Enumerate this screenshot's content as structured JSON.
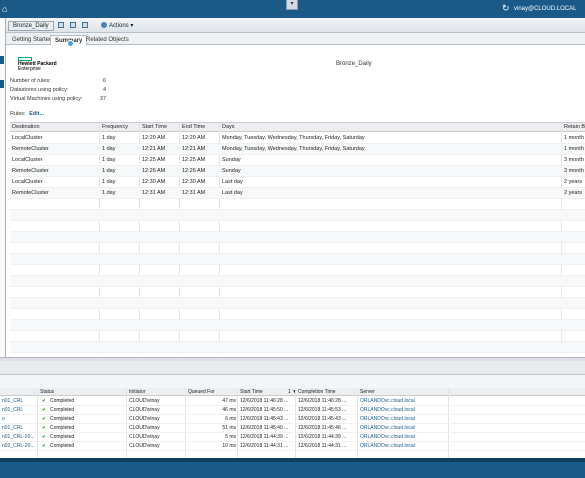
{
  "header": {
    "user": "vinay@CLOUD.LOCAL"
  },
  "toolbar": {
    "object_name": "Bronze_Daily",
    "actions_label": "Actions"
  },
  "tabs": [
    "Getting Started",
    "Summary",
    "Related Objects"
  ],
  "summary": {
    "logo_line1": "Hewlett Packard",
    "logo_line2": "Enterprise",
    "policy_name": "Bronze_Daily",
    "stats": [
      {
        "label": "Number of rules:",
        "value": "6"
      },
      {
        "label": "Datastores using policy:",
        "value": "4"
      },
      {
        "label": "Virtual Machines using policy:",
        "value": "37"
      }
    ],
    "rules_label": "Rules:",
    "edit_link": "Edit..."
  },
  "rules_table": {
    "columns": [
      "Destination",
      "Frequency",
      "Start Time",
      "End Time",
      "Days",
      "Retain B"
    ],
    "rows": [
      [
        "LocalCluster",
        "1 day",
        "12:20 AM",
        "12:20 AM",
        "Monday, Tuesday, Wednesday, Thursday, Friday, Saturday",
        "1 month"
      ],
      [
        "RemoteCluster",
        "1 day",
        "12:21 AM",
        "12:21 AM",
        "Monday, Tuesday, Wednesday, Thursday, Friday, Saturday",
        "1 month"
      ],
      [
        "LocalCluster",
        "1 day",
        "12:25 AM",
        "12:25 AM",
        "Sunday",
        "3 month"
      ],
      [
        "RemoteCluster",
        "1 day",
        "12:26 AM",
        "12:26 AM",
        "Sunday",
        "3 month"
      ],
      [
        "LocalCluster",
        "1 day",
        "12:30 AM",
        "12:30 AM",
        "Last day",
        "2 years"
      ],
      [
        "RemoteCluster",
        "1 day",
        "12:31 AM",
        "12:31 AM",
        "Last day",
        "2 years"
      ]
    ]
  },
  "tasks_table": {
    "columns": [
      "",
      "Status",
      "Initiator",
      "Queued For",
      "Start Time",
      "Completion Time",
      "Server"
    ],
    "sort_indicator": "1 ▼",
    "rows": [
      [
        "n01_CRL",
        "Completed",
        "CLOUD\\vinay",
        "47 ms",
        "12/6/2018 11:46:28 ...",
        "12/6/2018 11:46:28 ...",
        "ORLANDOvc.cloud.local"
      ],
      [
        "n01_CRL",
        "Completed",
        "CLOUD\\vinay",
        "46 ms",
        "12/6/2018 11:45:50 ...",
        "12/6/2018 11:45:53 ...",
        "ORLANDOvc.cloud.local"
      ],
      [
        "o",
        "Completed",
        "CLOUD\\vinay",
        "6 ms",
        "12/6/2018 11:45:43 ...",
        "12/6/2018 11:45:43 ...",
        "ORLANDOvc.cloud.local"
      ],
      [
        "n01_CRL",
        "Completed",
        "CLOUD\\vinay",
        "51 ms",
        "12/6/2018 11:45:40 ...",
        "12/6/2018 11:45:46 ...",
        "ORLANDOvc.cloud.local"
      ],
      [
        "n01_CRL-20...",
        "Completed",
        "CLOUD\\vinay",
        "5 ms",
        "12/6/2018 11:44:39 ...",
        "12/6/2018 11:44:39 ...",
        "ORLANDOvc.cloud.local"
      ],
      [
        "n02_CRL-20...",
        "Completed",
        "CLOUD\\vinay",
        "10 ms",
        "12/6/2018 11:44:31 ...",
        "12/6/2018 11:44:31 ...",
        "ORLANDOvc.cloud.local"
      ]
    ]
  },
  "colors": {
    "brand": "#1b5a86",
    "hpe_green": "#01a982",
    "success": "#2e9d35"
  },
  "icons": [
    "home-icon",
    "dropdown-icon",
    "refresh-icon",
    "gear-icon",
    "check-icon"
  ]
}
